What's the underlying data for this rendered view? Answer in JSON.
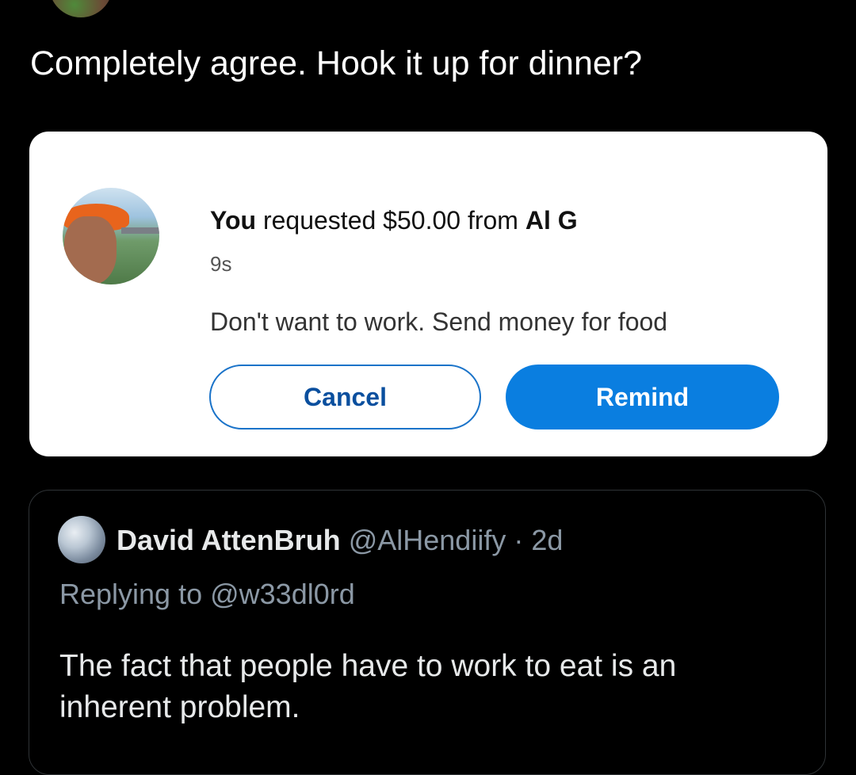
{
  "tweet": {
    "text": "Completely agree. Hook it up for dinner?"
  },
  "payment_card": {
    "title_prefix": "You",
    "title_middle": " requested $50.00 from ",
    "title_recipient": "Al G",
    "time": "9s",
    "note": "Don't want to work. Send money for food",
    "cancel_label": "Cancel",
    "remind_label": "Remind"
  },
  "quoted_tweet": {
    "name": "David AttenBruh",
    "handle": "@AlHendiify",
    "separator": "·",
    "age": "2d",
    "replying_prefix": "Replying to ",
    "replying_to": "@w33dl0rd",
    "text": "The fact that people have to work to eat is an inherent problem."
  },
  "colors": {
    "background": "#000000",
    "card_background": "#ffffff",
    "accent_blue": "#0a7ee0",
    "muted_text": "#8b98a5"
  }
}
